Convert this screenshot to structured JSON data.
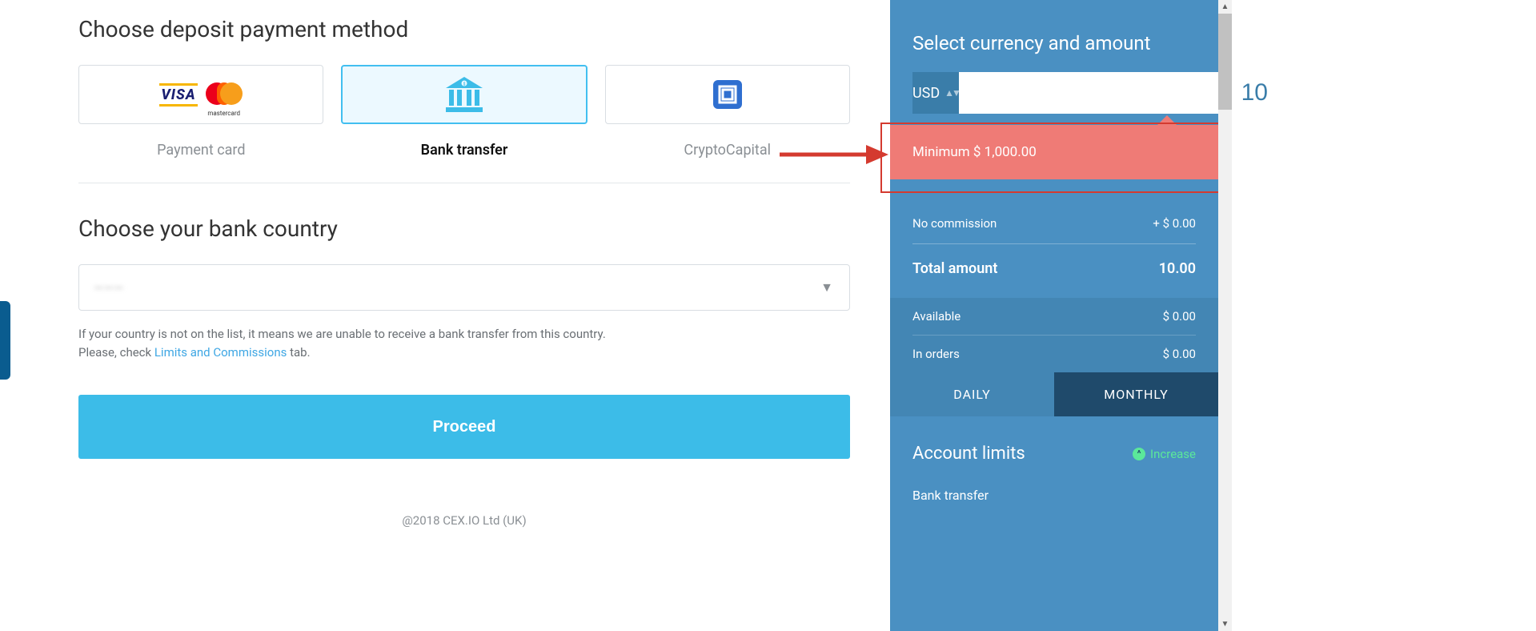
{
  "main": {
    "title_pm": "Choose deposit payment method",
    "payment_methods": [
      {
        "label": "Payment card"
      },
      {
        "label": "Bank transfer"
      },
      {
        "label": "CryptoCapital"
      }
    ],
    "title_country": "Choose your bank country",
    "country_value": "———",
    "hint_line1": "If your country is not on the list, it means we are unable to receive a bank transfer from this country.",
    "hint_line2a": "Please, check ",
    "hint_link": "Limits and Commissions",
    "hint_line2b": " tab.",
    "proceed": "Proceed",
    "footer": "@2018 CEX.IO Ltd (UK)"
  },
  "sidebar": {
    "title": "Select currency and amount",
    "currency": "USD",
    "amount": "10",
    "error": "Minimum $ 1,000.00",
    "commission_label": "No commission",
    "commission_value": "+ $ 0.00",
    "total_label": "Total amount",
    "total_value": "10.00",
    "available_label": "Available",
    "available_value": "$ 0.00",
    "inorders_label": "In orders",
    "inorders_value": "$ 0.00",
    "tabs": {
      "daily": "DAILY",
      "monthly": "MONTHLY"
    },
    "limits_title": "Account limits",
    "increase": "Increase",
    "limits_item": "Bank transfer"
  }
}
